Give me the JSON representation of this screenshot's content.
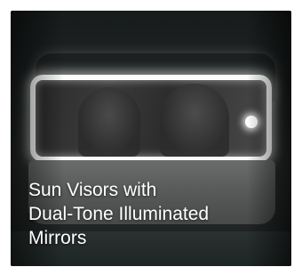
{
  "caption": {
    "lines": [
      "Sun Visors with",
      "Dual-Tone Illuminated",
      "Mirrors"
    ]
  }
}
